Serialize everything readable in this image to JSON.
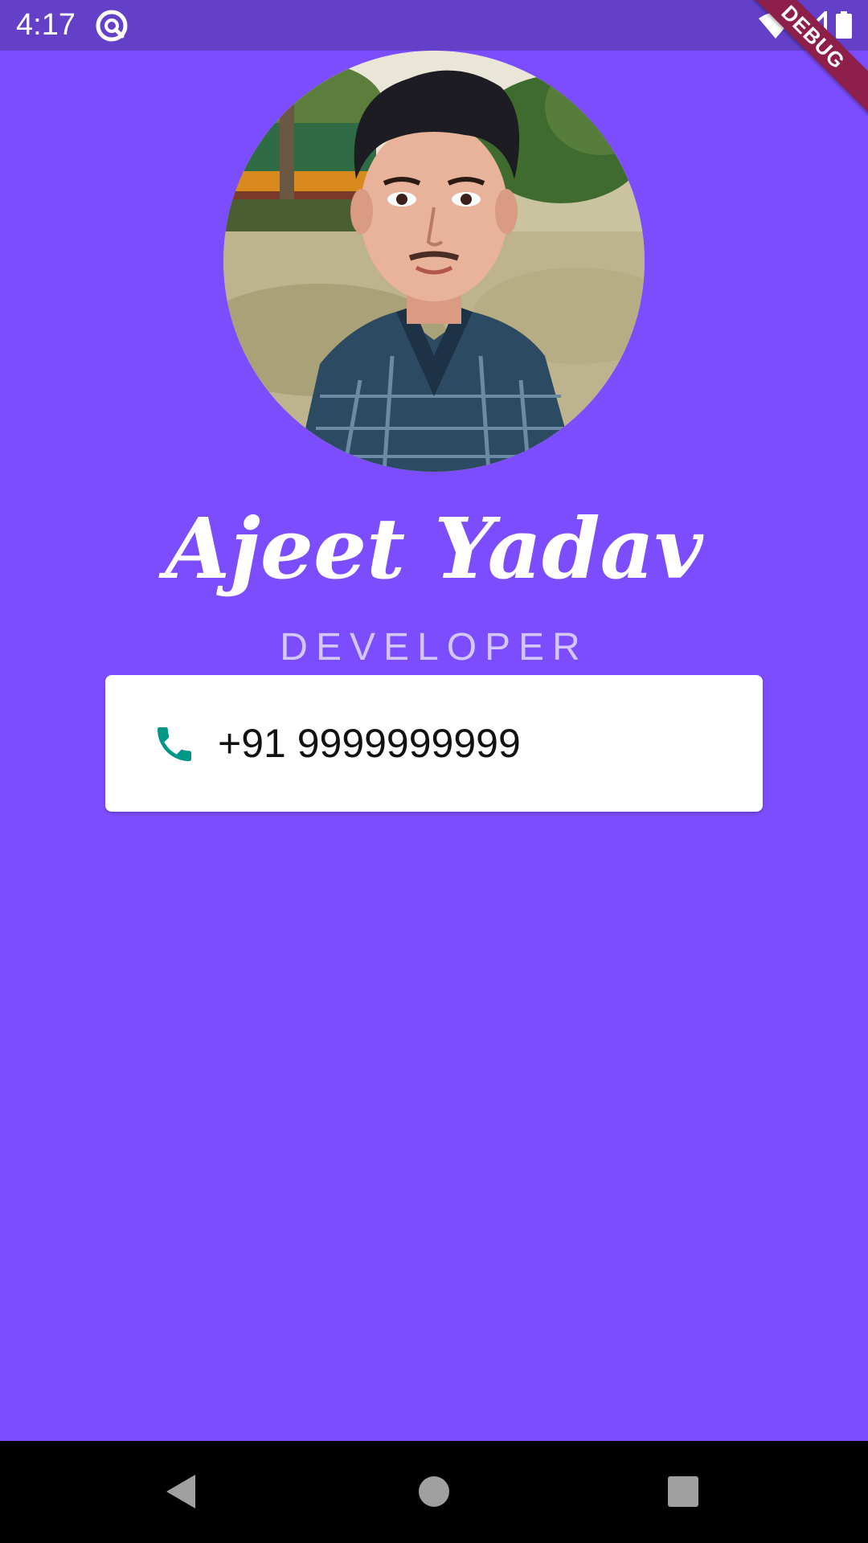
{
  "status_bar": {
    "time": "4:17",
    "app_icon": "at-sign-icon",
    "wifi_icon": "wifi-icon",
    "signal_icon": "signal-icon",
    "battery_icon": "battery-icon"
  },
  "debug_banner": "DEBUG",
  "profile": {
    "photo": "profile-photo",
    "name": "Ajeet Yadav",
    "title": "DEVELOPER"
  },
  "phone_card": {
    "icon": "phone-icon",
    "number": "+91 9999999999"
  },
  "nav_bar": {
    "back_icon": "back-icon",
    "home_icon": "home-icon",
    "recents_icon": "recents-icon"
  },
  "colors": {
    "background": "#7c4dff",
    "status_bar": "#6440c9",
    "debug_banner": "#8e1f4b",
    "phone_icon": "#009688",
    "card": "#ffffff",
    "title_text": "#d4c6ff"
  }
}
